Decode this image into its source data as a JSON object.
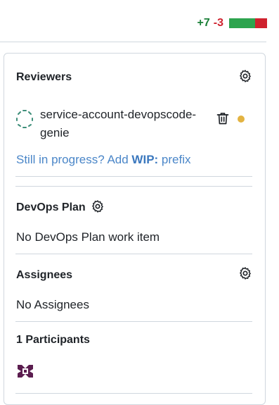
{
  "diffstat": {
    "additions": "+7",
    "deletions": "-3"
  },
  "reviewers": {
    "title": "Reviewers",
    "reviewer_name": "service-account-devopscode-genie",
    "status_color": "#e3b341",
    "wip_prefix_text": "Still in progress? Add ",
    "wip_keyword": "WIP:",
    "wip_suffix_text": " prefix"
  },
  "devops_plan": {
    "title": "DevOps Plan",
    "empty_text": "No DevOps Plan work item"
  },
  "assignees": {
    "title": "Assignees",
    "empty_text": "No Assignees"
  },
  "participants": {
    "title": "1 Participants"
  },
  "icons": {
    "settings": "gear-icon",
    "delete": "trash-icon",
    "reviewer_avatar": "avatar",
    "participant_avatar": "avatar"
  },
  "colors": {
    "additions": "#1a7f37",
    "deletions": "#cf222e",
    "link": "#4a86c8"
  }
}
